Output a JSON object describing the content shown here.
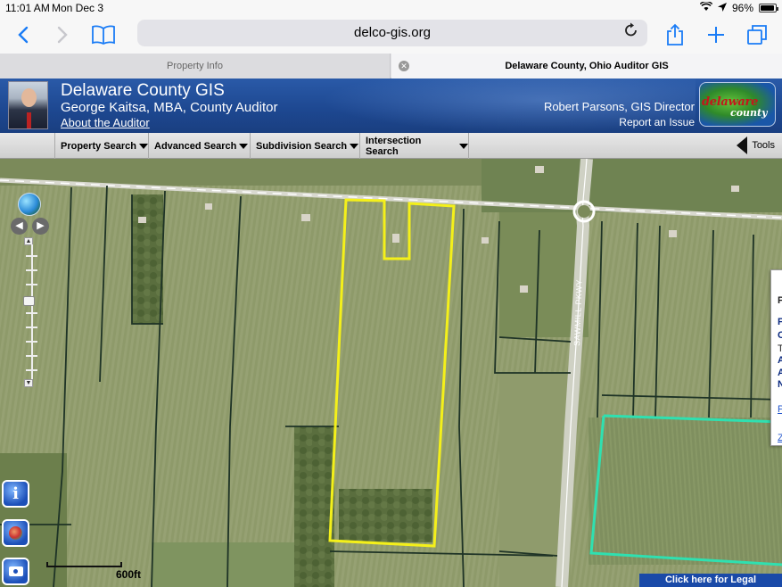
{
  "status_bar": {
    "time": "11:01 AM",
    "date": "Mon Dec 3",
    "battery": "96%",
    "battery_level": 0.96,
    "icons": [
      "wifi-icon",
      "location-icon",
      "battery-icon"
    ]
  },
  "browser": {
    "url": "delco-gis.org",
    "icons": [
      "back-icon",
      "forward-icon",
      "bookmarks-icon",
      "reload-icon",
      "share-icon",
      "add-tab-icon",
      "tabs-icon"
    ],
    "tabs": [
      {
        "label": "Property Info"
      },
      {
        "label": "Delaware County, Ohio Auditor GIS"
      }
    ]
  },
  "banner": {
    "title": "Delaware County GIS",
    "subtitle": "George Kaitsa, MBA, County Auditor",
    "about_link": "About the Auditor",
    "director": "Robert Parsons, GIS Director",
    "report_link": "Report an Issue",
    "logo_line1": "delaware",
    "logo_line2": "county"
  },
  "menu": {
    "items": [
      {
        "label": "Property Search"
      },
      {
        "label": "Advanced Search"
      },
      {
        "label": "Subdivision Search"
      },
      {
        "label": "Intersection Search"
      }
    ],
    "tools_label": "Tools"
  },
  "map": {
    "road_label": "SAWMILL PKWY",
    "scale_label": "600ft",
    "disclaimer": "Click here for Legal Disclaimer",
    "popup_chars": [
      "P",
      "P",
      "C",
      "T",
      "A",
      "A",
      "N",
      "P",
      "Z"
    ],
    "colors": {
      "selected_parcel": "#f4f01a",
      "adjacent_parcel": "#2fe0b0",
      "parcel_lines": "#1e3326"
    }
  }
}
